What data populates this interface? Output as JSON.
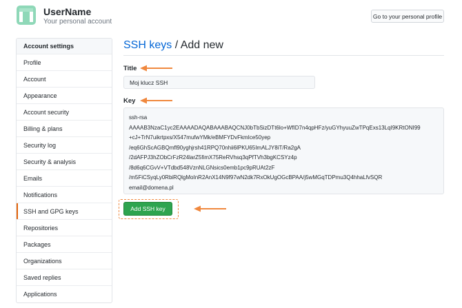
{
  "header": {
    "username": "UserName",
    "subtitle": "Your personal account",
    "profile_button": "Go to your personal profile"
  },
  "sidebar": {
    "items": [
      {
        "label": "Account settings",
        "type": "heading"
      },
      {
        "label": "Profile"
      },
      {
        "label": "Account"
      },
      {
        "label": "Appearance"
      },
      {
        "label": "Account security"
      },
      {
        "label": "Billing & plans"
      },
      {
        "label": "Security log"
      },
      {
        "label": "Security & analysis"
      },
      {
        "label": "Emails"
      },
      {
        "label": "Notifications"
      },
      {
        "label": "SSH and GPG keys",
        "selected": true
      },
      {
        "label": "Repositories"
      },
      {
        "label": "Packages"
      },
      {
        "label": "Organizations"
      },
      {
        "label": "Saved replies"
      },
      {
        "label": "Applications"
      }
    ]
  },
  "main": {
    "heading_link": "SSH keys",
    "heading_rest": " / Add new",
    "title_label": "Title",
    "title_value": "Moj klucz SSH",
    "key_label": "Key",
    "key_lines": [
      "ssh-rsa",
      "AAAAB3NzaC1yc2EAAAADAQABAAABAQCNJ0bTbSizDTt6lo+WfID7n4qpHFz/yuGYhyuuZwTPqExs13LqI9KRtONI99",
      "+cJ+TrN7uikrtpxs/X547mufwYMk/eBMFYDvFkmIce50yep",
      "/eq6GhScAGBQmfl90yghjrsh41RPQ70nhii6lPKU65ImALJY8iT/Ra2gA",
      "/2dAFPJ3hZObCrFzR24larZ5fimX75ReRVhsq3qPfTVh3bgKCSYz4p",
      "/8d6q6CGvV+VTdbd548VznNLGNsics0emb1pc9pRUAt2zF",
      "/m5FiCSyqLy0RbiRQlgMoInR2AnX14N9f97wN2dk7RxOkUgOGcBPAA/j5wMGqTDPmu3Q4hhaLfvSQR",
      "email@domena.pl"
    ],
    "add_button": "Add SSH key"
  },
  "colors": {
    "accent_link": "#0366d6",
    "button_green": "#2ea44f",
    "annotation_orange": "#f0883e"
  },
  "icons": [
    "avatar-identicon",
    "arrow-left-annotation"
  ]
}
